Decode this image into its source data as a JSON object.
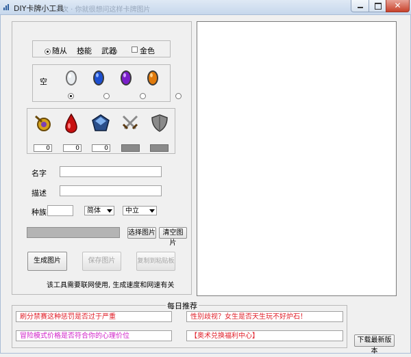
{
  "window": {
    "title": "DIY卡牌小工具",
    "ghost_title": "二次 · 你就很想问这样卡牌图片",
    "close_glyph": "✕"
  },
  "card_type": {
    "options": [
      "随从",
      "技能",
      "武器"
    ],
    "selected": "随从",
    "golden_label": "金色"
  },
  "gems": {
    "empty_label": "空",
    "options": [
      "empty",
      "silver-gem",
      "blue-gem",
      "purple-gem",
      "orange-gem"
    ],
    "selected": "empty"
  },
  "stats": {
    "icons": [
      "mana-icon",
      "health-drop-icon",
      "crystal-icon",
      "crossed-swords-icon",
      "shield-icon"
    ],
    "values": [
      "0",
      "0",
      "0"
    ]
  },
  "form": {
    "name_label": "名字",
    "desc_label": "描述",
    "race_label": "种族",
    "lang_value": "简体",
    "align_value": "中立"
  },
  "image": {
    "choose_label": "选择图片",
    "clear_label": "清空图片"
  },
  "actions": {
    "generate_label": "生成图片",
    "save_label": "保存图片",
    "copy_label": "复制到粘贴板",
    "note": "该工具需要联网使用, 生成速度和网速有关"
  },
  "recommend": {
    "title": "每日推荐",
    "links": [
      {
        "text": "刷分禁赛这种惩罚是否过于严重",
        "color": "#e0202a"
      },
      {
        "text": "性别歧视？女生是否天生玩不好炉石！",
        "color": "#e0202a"
      },
      {
        "text": "冒险模式价格是否符合你的心理价位",
        "color": "#d020c8"
      },
      {
        "text": "【奥术兑换福利中心】",
        "color": "#e0202a"
      }
    ],
    "download_label": "下载最新版本"
  }
}
